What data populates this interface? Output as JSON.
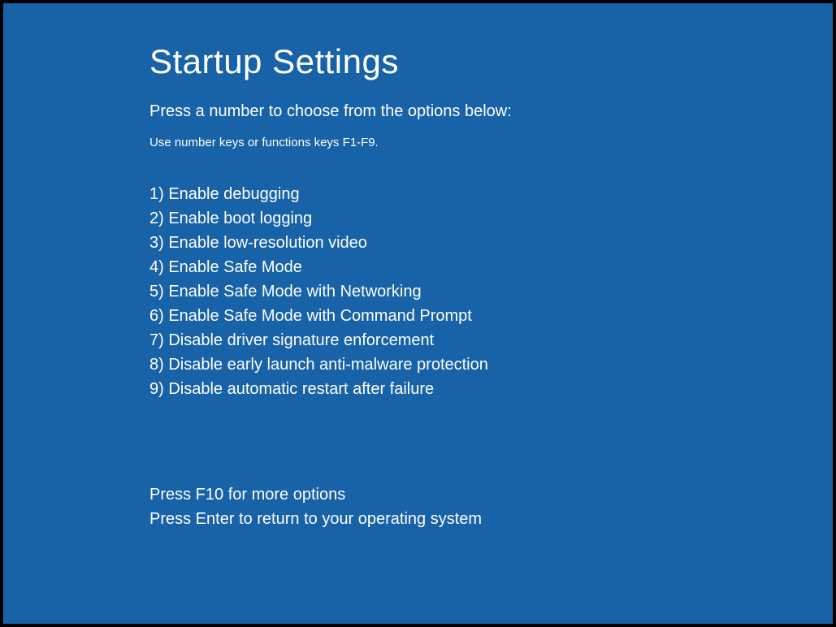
{
  "title": "Startup Settings",
  "subtitle": "Press a number to choose from the options below:",
  "hint": "Use number keys or functions keys F1-F9.",
  "options": [
    "1) Enable debugging",
    "2) Enable boot logging",
    "3) Enable low-resolution video",
    "4) Enable Safe Mode",
    "5) Enable Safe Mode with Networking",
    "6) Enable Safe Mode with Command Prompt",
    "7) Disable driver signature enforcement",
    "8) Disable early launch anti-malware protection",
    "9) Disable automatic restart after failure"
  ],
  "footer": {
    "more_options": "Press F10 for more options",
    "return": "Press Enter to return to your operating system"
  }
}
